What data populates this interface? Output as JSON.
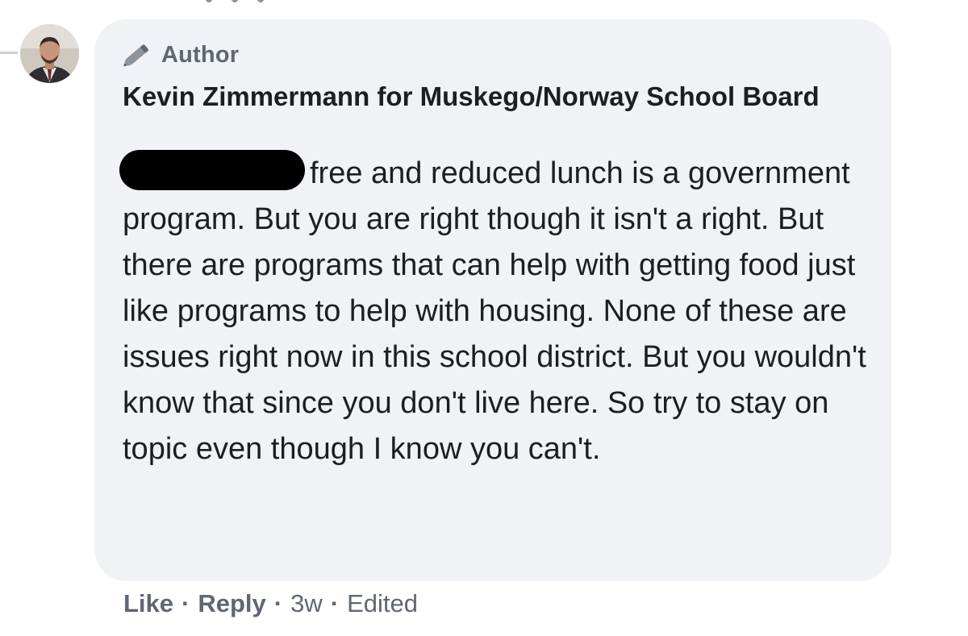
{
  "comment": {
    "badge_label": "Author",
    "badge_icon": "pen-icon",
    "author_name": "Kevin Zimmermann for Muskego/Norway School Board",
    "redacted_mention": true,
    "body_after_mention": "free and reduced lunch is a government program. But you are right though it isn't a right. But there are programs that can help with getting food just like programs to help with housing. None of these are issues right now in this school district. But you wouldn't know that since you don't live here. So try to stay on topic even though I know you can't."
  },
  "actions": {
    "like_label": "Like",
    "reply_label": "Reply",
    "separator": "·",
    "age": "3w",
    "edited_label": "Edited"
  },
  "colors": {
    "bubble_bg": "#f0f2f5",
    "text_primary": "#1c1e21",
    "text_secondary": "#606770"
  }
}
